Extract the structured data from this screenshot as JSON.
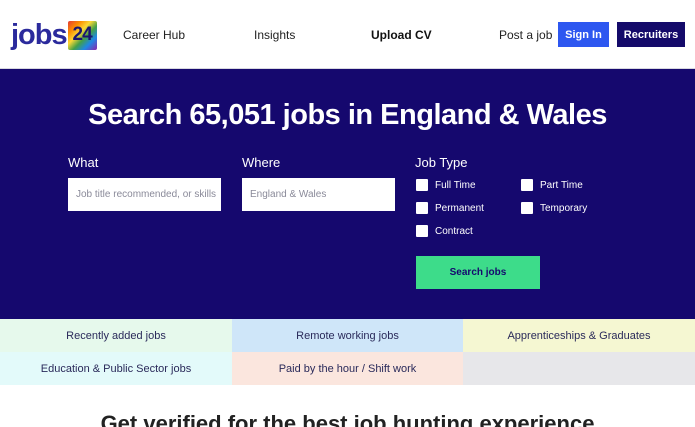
{
  "header": {
    "logo_text": "jobs",
    "logo_badge": "24",
    "nav": [
      {
        "label": "Career Hub"
      },
      {
        "label": "Insights"
      },
      {
        "label": "Upload CV"
      },
      {
        "label": "Post a job"
      }
    ],
    "signin_label": "Sign In",
    "recruiters_label": "Recruiters"
  },
  "hero": {
    "title": "Search 65,051 jobs in England & Wales",
    "what_label": "What",
    "what_placeholder": "Job title recommended, or skills",
    "where_label": "Where",
    "where_placeholder": "England & Wales",
    "jobtype_label": "Job Type",
    "job_types": [
      {
        "label": "Full Time",
        "checked": false
      },
      {
        "label": "Part Time",
        "checked": false
      },
      {
        "label": "Permanent",
        "checked": false
      },
      {
        "label": "Temporary",
        "checked": false
      },
      {
        "label": "Contract",
        "checked": false
      }
    ],
    "search_label": "Search jobs"
  },
  "tiles": [
    {
      "label": "Recently added jobs",
      "color": "#e6f9ec"
    },
    {
      "label": "Remote working jobs",
      "color": "#cfe6f9"
    },
    {
      "label": "Apprenticeships & Graduates",
      "color": "#f5f7d2"
    },
    {
      "label": "Education & Public Sector jobs",
      "color": "#e3fafa"
    },
    {
      "label": "Paid by the hour / Shift work",
      "color": "#fbe6de"
    },
    {
      "label": "",
      "color": "#e7e7ea"
    }
  ],
  "bottom": {
    "title": "Get verified for the best job hunting experience"
  },
  "colors": {
    "brand_navy": "#15086e",
    "signin_blue": "#2d57f0",
    "search_green": "#3ddc8a"
  }
}
